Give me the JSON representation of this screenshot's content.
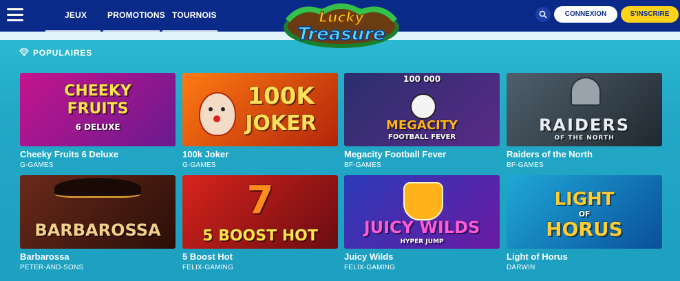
{
  "header": {
    "nav": [
      {
        "label": "JEUX"
      },
      {
        "label": "PROMOTIONS"
      },
      {
        "label": "TOURNOIS"
      }
    ],
    "logo": {
      "line1": "Lucky",
      "line2": "Treasure"
    },
    "login_label": "CONNEXION",
    "signup_label": "S'INSCRIRE"
  },
  "section": {
    "title": "POPULAIRES"
  },
  "games": [
    {
      "name": "Cheeky Fruits 6 Deluxe",
      "provider": "G-GAMES",
      "art_line1": "CHEEKY",
      "art_line2": "FRUITS",
      "art_line3": "6 DELUXE",
      "colors": [
        "#c4148e",
        "#6b1a8f"
      ]
    },
    {
      "name": "100k Joker",
      "provider": "G-GAMES",
      "art_line1": "100K",
      "art_line2": "JOKER",
      "art_line3": "",
      "colors": [
        "#ff7b12",
        "#b2250a"
      ]
    },
    {
      "name": "Megacity Football Fever",
      "provider": "BF-GAMES",
      "art_line1": "100 000",
      "art_line2": "MEGACITY",
      "art_line3": "FOOTBALL FEVER",
      "colors": [
        "#2a2f6e",
        "#5a2a86"
      ]
    },
    {
      "name": "Raiders of the North",
      "provider": "BF-GAMES",
      "art_line1": "RAIDERS",
      "art_line2": "OF THE NORTH",
      "art_line3": "",
      "colors": [
        "#50606c",
        "#202830"
      ]
    },
    {
      "name": "Barbarossa",
      "provider": "PETER-AND-SONS",
      "art_line1": "BARBAROSSA",
      "art_line2": "",
      "art_line3": "",
      "colors": [
        "#6a2a1a",
        "#2a0e08"
      ]
    },
    {
      "name": "5 Boost Hot",
      "provider": "FELIX-GAMING",
      "art_line1": "7",
      "art_line2": "5 BOOST HOT",
      "art_line3": "",
      "colors": [
        "#d8241c",
        "#6a0c12"
      ]
    },
    {
      "name": "Juicy Wilds",
      "provider": "FELIX-GAMING",
      "art_line1": "JUICY WILDS",
      "art_line2": "HYPER JUMP",
      "art_line3": "",
      "colors": [
        "#2b3bb8",
        "#6a1aa2"
      ]
    },
    {
      "name": "Light of Horus",
      "provider": "DARWIN",
      "art_line1": "LIGHT",
      "art_line2": "OF",
      "art_line3": "HORUS",
      "colors": [
        "#1fa8d8",
        "#0a4f9a"
      ]
    }
  ]
}
